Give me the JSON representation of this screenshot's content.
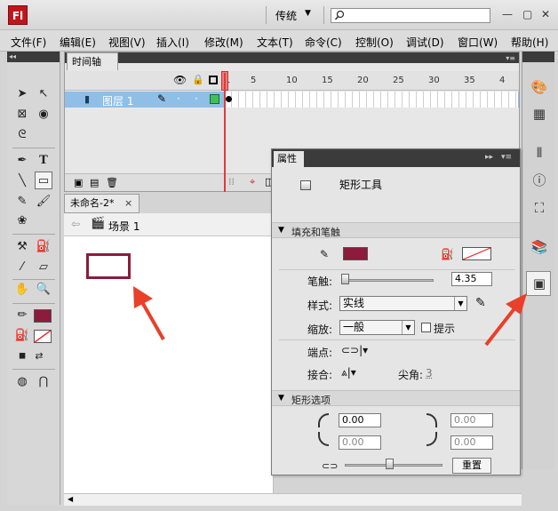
{
  "app": {
    "logo": "Fl",
    "workspace": "传统",
    "search_placeholder": ""
  },
  "menu": [
    "文件(F)",
    "编辑(E)",
    "视图(V)",
    "插入(I)",
    "修改(M)",
    "文本(T)",
    "命令(C)",
    "控制(O)",
    "调试(D)",
    "窗口(W)",
    "帮助(H)"
  ],
  "timeline": {
    "tab": "时间轴",
    "frame_numbers": [
      "1",
      "5",
      "10",
      "15",
      "20",
      "25",
      "30",
      "35",
      "4"
    ],
    "layer_name": "图层 1"
  },
  "document": {
    "tab": "未命名-2*",
    "close": "×",
    "scene": "场景 1"
  },
  "properties": {
    "tab": "属性",
    "tool_name": "矩形工具",
    "section_fill_stroke": "填充和笔触",
    "stroke_label": "笔触:",
    "stroke_value": "4.35",
    "style_label": "样式:",
    "style_value": "实线",
    "scale_label": "缩放:",
    "scale_value": "一般",
    "hint_label": "提示",
    "cap_label": "端点:",
    "join_label": "接合:",
    "miter_label": "尖角:",
    "miter_value": "3",
    "section_rect": "矩形选项",
    "corner_tl": "0.00",
    "corner_tr": "0.00",
    "corner_bl": "0.00",
    "corner_br": "0.00",
    "reset_button": "重置"
  },
  "colors": {
    "stroke": "#8c1b3c",
    "fill_none": "#ffffff",
    "annotation": "#e8402a",
    "layer_highlight": "#8fbfe6"
  }
}
